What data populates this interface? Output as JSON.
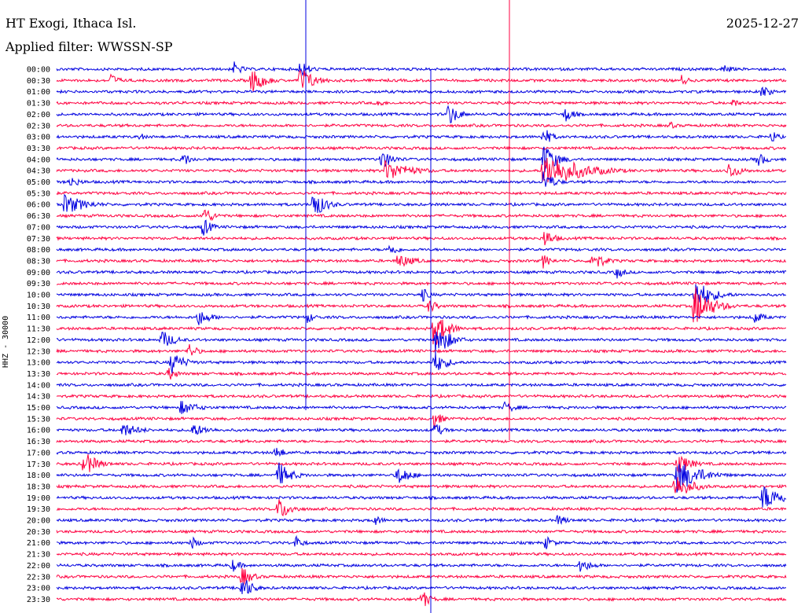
{
  "header": {
    "station": "HT Exogi, Ithaca Isl.",
    "date": "2025-12-27",
    "filter": "Applied filter: WWSSN-SP"
  },
  "chart_data": {
    "type": "line",
    "title": "",
    "ylabel": "HHZ - 30000",
    "rows": [
      "00:00",
      "00:30",
      "01:00",
      "01:30",
      "02:00",
      "02:30",
      "03:00",
      "03:30",
      "04:00",
      "04:30",
      "05:00",
      "05:30",
      "06:00",
      "06:30",
      "07:00",
      "07:30",
      "08:00",
      "08:30",
      "09:00",
      "09:30",
      "10:00",
      "10:30",
      "11:00",
      "11:30",
      "12:00",
      "12:30",
      "13:00",
      "13:30",
      "14:00",
      "14:30",
      "15:00",
      "15:30",
      "16:00",
      "16:30",
      "17:00",
      "17:30",
      "18:00",
      "18:30",
      "19:00",
      "19:30",
      "20:00",
      "20:30",
      "21:00",
      "21:30",
      "22:00",
      "22:30",
      "23:00",
      "23:30"
    ],
    "colors": [
      "#0000e0",
      "#ff0040"
    ],
    "events": [
      {
        "row": 0,
        "minute": 7.3,
        "amp": 10,
        "dur": 1.0
      },
      {
        "row": 0,
        "minute": 10.0,
        "amp": 12,
        "dur": 1.2
      },
      {
        "row": 0,
        "minute": 27.4,
        "amp": 8,
        "dur": 1.0
      },
      {
        "row": 1,
        "minute": 2.2,
        "amp": 10,
        "dur": 1.0
      },
      {
        "row": 1,
        "minute": 8.0,
        "amp": 18,
        "dur": 1.5
      },
      {
        "row": 1,
        "minute": 10.0,
        "amp": 20,
        "dur": 1.6
      },
      {
        "row": 1,
        "minute": 25.7,
        "amp": 8,
        "dur": 0.8
      },
      {
        "row": 2,
        "minute": 29.0,
        "amp": 10,
        "dur": 1.0
      },
      {
        "row": 3,
        "minute": 13.2,
        "amp": 7,
        "dur": 0.8
      },
      {
        "row": 3,
        "minute": 27.8,
        "amp": 7,
        "dur": 0.8
      },
      {
        "row": 4,
        "minute": 16.1,
        "amp": 16,
        "dur": 1.2
      },
      {
        "row": 4,
        "minute": 20.9,
        "amp": 12,
        "dur": 1.0
      },
      {
        "row": 5,
        "minute": 25.2,
        "amp": 6,
        "dur": 0.8
      },
      {
        "row": 6,
        "minute": 3.4,
        "amp": 6,
        "dur": 0.8
      },
      {
        "row": 6,
        "minute": 20.0,
        "amp": 14,
        "dur": 1.0
      },
      {
        "row": 6,
        "minute": 29.4,
        "amp": 10,
        "dur": 0.8
      },
      {
        "row": 8,
        "minute": 5.2,
        "amp": 10,
        "dur": 1.0
      },
      {
        "row": 8,
        "minute": 13.3,
        "amp": 14,
        "dur": 1.5
      },
      {
        "row": 8,
        "minute": 20.0,
        "amp": 22,
        "dur": 1.5
      },
      {
        "row": 8,
        "minute": 28.8,
        "amp": 10,
        "dur": 1.2
      },
      {
        "row": 9,
        "minute": 13.5,
        "amp": 14,
        "dur": 3.0
      },
      {
        "row": 9,
        "minute": 20.0,
        "amp": 26,
        "dur": 4.0
      },
      {
        "row": 9,
        "minute": 27.6,
        "amp": 12,
        "dur": 1.5
      },
      {
        "row": 10,
        "minute": 0.5,
        "amp": 8,
        "dur": 1.5
      },
      {
        "row": 10,
        "minute": 20.0,
        "amp": 16,
        "dur": 1.2
      },
      {
        "row": 12,
        "minute": 0.3,
        "amp": 14,
        "dur": 2.5
      },
      {
        "row": 12,
        "minute": 10.5,
        "amp": 20,
        "dur": 1.5
      },
      {
        "row": 13,
        "minute": 6.0,
        "amp": 14,
        "dur": 1.2
      },
      {
        "row": 14,
        "minute": 6.0,
        "amp": 14,
        "dur": 1.0
      },
      {
        "row": 15,
        "minute": 20.0,
        "amp": 14,
        "dur": 1.2
      },
      {
        "row": 16,
        "minute": 13.7,
        "amp": 10,
        "dur": 1.0
      },
      {
        "row": 17,
        "minute": 14.0,
        "amp": 10,
        "dur": 2.0
      },
      {
        "row": 17,
        "minute": 22.0,
        "amp": 14,
        "dur": 1.5
      },
      {
        "row": 17,
        "minute": 20.0,
        "amp": 10,
        "dur": 1.0
      },
      {
        "row": 18,
        "minute": 23.0,
        "amp": 10,
        "dur": 1.0
      },
      {
        "row": 20,
        "minute": 26.2,
        "amp": 22,
        "dur": 2.0
      },
      {
        "row": 20,
        "minute": 15.0,
        "amp": 12,
        "dur": 0.8
      },
      {
        "row": 21,
        "minute": 26.2,
        "amp": 28,
        "dur": 2.0
      },
      {
        "row": 21,
        "minute": 15.3,
        "amp": 10,
        "dur": 1.0
      },
      {
        "row": 22,
        "minute": 5.8,
        "amp": 12,
        "dur": 1.5
      },
      {
        "row": 22,
        "minute": 10.3,
        "amp": 8,
        "dur": 1.0
      },
      {
        "row": 22,
        "minute": 28.7,
        "amp": 10,
        "dur": 1.0
      },
      {
        "row": 23,
        "minute": 15.5,
        "amp": 26,
        "dur": 1.5
      },
      {
        "row": 24,
        "minute": 4.3,
        "amp": 14,
        "dur": 1.5
      },
      {
        "row": 24,
        "minute": 15.6,
        "amp": 24,
        "dur": 1.5
      },
      {
        "row": 25,
        "minute": 5.4,
        "amp": 12,
        "dur": 1.0
      },
      {
        "row": 26,
        "minute": 4.7,
        "amp": 16,
        "dur": 1.5
      },
      {
        "row": 26,
        "minute": 15.5,
        "amp": 16,
        "dur": 1.5
      },
      {
        "row": 27,
        "minute": 4.6,
        "amp": 10,
        "dur": 1.0
      },
      {
        "row": 30,
        "minute": 5.1,
        "amp": 10,
        "dur": 2.0
      },
      {
        "row": 30,
        "minute": 18.4,
        "amp": 8,
        "dur": 1.5
      },
      {
        "row": 31,
        "minute": 15.5,
        "amp": 12,
        "dur": 1.0
      },
      {
        "row": 32,
        "minute": 2.7,
        "amp": 10,
        "dur": 2.0
      },
      {
        "row": 32,
        "minute": 5.5,
        "amp": 10,
        "dur": 2.0
      },
      {
        "row": 32,
        "minute": 15.5,
        "amp": 12,
        "dur": 1.0
      },
      {
        "row": 34,
        "minute": 9.0,
        "amp": 10,
        "dur": 1.0
      },
      {
        "row": 35,
        "minute": 1.1,
        "amp": 18,
        "dur": 1.5
      },
      {
        "row": 35,
        "minute": 25.5,
        "amp": 16,
        "dur": 1.5
      },
      {
        "row": 36,
        "minute": 9.1,
        "amp": 18,
        "dur": 1.5
      },
      {
        "row": 36,
        "minute": 14.0,
        "amp": 14,
        "dur": 1.5
      },
      {
        "row": 36,
        "minute": 25.5,
        "amp": 24,
        "dur": 2.5
      },
      {
        "row": 37,
        "minute": 25.4,
        "amp": 18,
        "dur": 2.0
      },
      {
        "row": 38,
        "minute": 29.0,
        "amp": 18,
        "dur": 2.5
      },
      {
        "row": 39,
        "minute": 9.1,
        "amp": 16,
        "dur": 1.5
      },
      {
        "row": 40,
        "minute": 13.0,
        "amp": 8,
        "dur": 1.2
      },
      {
        "row": 40,
        "minute": 20.6,
        "amp": 8,
        "dur": 1.2
      },
      {
        "row": 42,
        "minute": 5.5,
        "amp": 10,
        "dur": 1.0
      },
      {
        "row": 42,
        "minute": 9.8,
        "amp": 10,
        "dur": 1.0
      },
      {
        "row": 42,
        "minute": 20.1,
        "amp": 10,
        "dur": 1.0
      },
      {
        "row": 44,
        "minute": 7.2,
        "amp": 10,
        "dur": 1.0
      },
      {
        "row": 44,
        "minute": 21.5,
        "amp": 10,
        "dur": 1.5
      },
      {
        "row": 45,
        "minute": 7.6,
        "amp": 14,
        "dur": 1.2
      },
      {
        "row": 46,
        "minute": 7.6,
        "amp": 18,
        "dur": 1.2
      },
      {
        "row": 47,
        "minute": 15.0,
        "amp": 14,
        "dur": 1.0
      }
    ]
  }
}
